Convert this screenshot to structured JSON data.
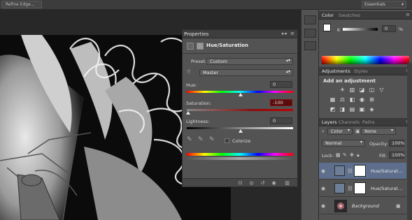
{
  "topbar": {
    "refine_label": "Refine Edge...",
    "workspace": "Essentials"
  },
  "properties": {
    "tab": "Properties",
    "panel_title": "Hue/Saturation",
    "preset_label": "Preset:",
    "preset_value": "Custom",
    "channel_value": "Master",
    "hue_label": "Hue:",
    "hue_value": "0",
    "saturation_label": "Saturation:",
    "saturation_value": "-100",
    "lightness_label": "Lightness:",
    "lightness_value": "0",
    "colorize_label": "Colorize",
    "controls": "▸▸ ≡"
  },
  "color_panel": {
    "tabs": [
      "Color",
      "Swatches"
    ],
    "k_label": "K",
    "k_value": "0",
    "k_unit": "%"
  },
  "adjustments_panel": {
    "tabs": [
      "Adjustments",
      "Styles"
    ],
    "heading": "Add an adjustment",
    "icons_row1": [
      "☀",
      "▥",
      "◪",
      "◫",
      "▽"
    ],
    "icons_row2": [
      "▦",
      "⚖",
      "◧",
      "◉",
      "⊞"
    ],
    "icons_row3": [
      "◩",
      "◨",
      "▤",
      "▣",
      "◈"
    ]
  },
  "layers_panel": {
    "tabs": [
      "Layers",
      "Channels",
      "Paths"
    ],
    "filter_kind": "Color",
    "filter_value": "None",
    "blend_mode": "Normal",
    "opacity_label": "Opacity:",
    "opacity_value": "100%",
    "lock_label": "Lock:",
    "fill_label": "Fill:",
    "fill_value": "100%",
    "layers": [
      {
        "name": "Hue/Saturat...",
        "selected": true
      },
      {
        "name": "Hue/Saturat...",
        "selected": false
      },
      {
        "name": "Background",
        "selected": false
      }
    ]
  },
  "colors": {
    "slider_red": "#7a1414",
    "saturation_field": "#5a0c0c",
    "selected_layer": "#5d6f8c"
  }
}
